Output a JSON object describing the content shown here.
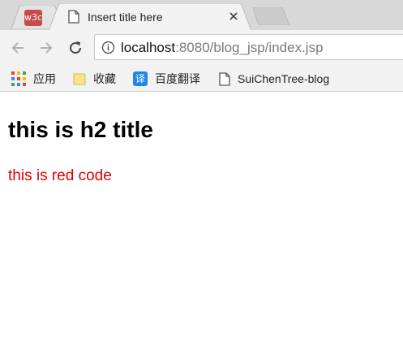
{
  "tabs": [
    {
      "favicon_text": "w3c",
      "active": false
    },
    {
      "title": "Insert title here",
      "active": true
    }
  ],
  "address_bar": {
    "host": "localhost",
    "path": ":8080/blog_jsp/index.jsp"
  },
  "bookmarks": [
    {
      "label": "应用",
      "icon": "apps-grid-icon"
    },
    {
      "label": "收藏",
      "icon": "folder-icon"
    },
    {
      "label": "百度翻译",
      "icon": "translate-icon",
      "icon_text": "译"
    },
    {
      "label": "SuiChenTree-blog",
      "icon": "page-icon"
    }
  ],
  "page": {
    "heading": "this is h2 title",
    "red_text": "this is red code"
  },
  "colors": {
    "red_text": "#e00000",
    "translate_icon": "#1e88e5",
    "w3c_badge": "#c84b4b"
  }
}
